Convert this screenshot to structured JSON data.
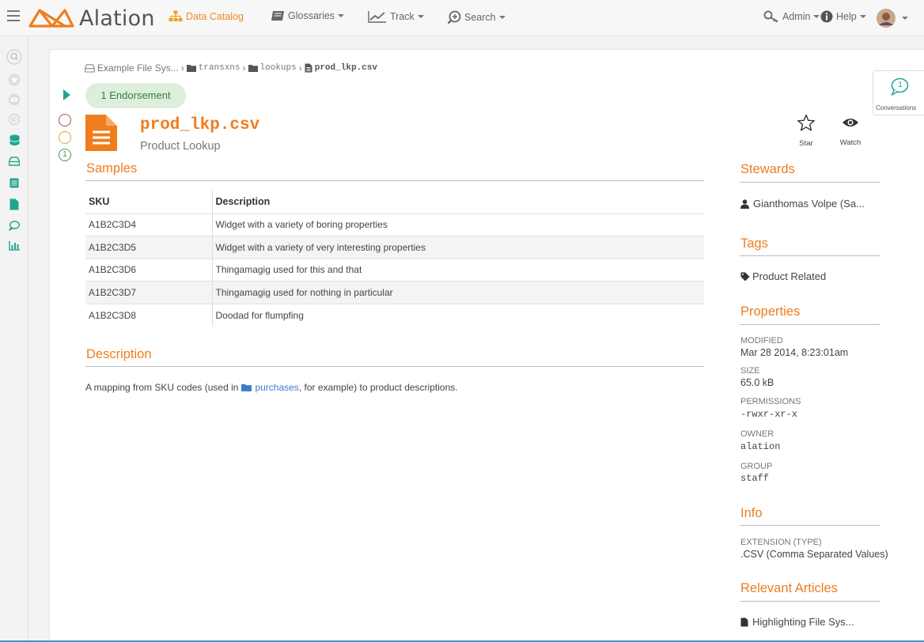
{
  "nav": {
    "brand": "Alation",
    "items": [
      {
        "label": "Data Catalog",
        "icon": "sitemap-icon"
      },
      {
        "label": "Glossaries",
        "icon": "book-icon"
      },
      {
        "label": "Track",
        "icon": "line-chart-icon"
      },
      {
        "label": "Search",
        "icon": "search-plus-icon"
      }
    ],
    "admin": "Admin",
    "help": "Help"
  },
  "breadcrumb": {
    "root": "Example File Sys...",
    "dir1": "transxns",
    "dir2": "lookups",
    "file": "prod_lkp.csv"
  },
  "endorsement": "1 Endorsement",
  "flags": {
    "endorse_count": "1"
  },
  "header": {
    "title": "prod_lkp.csv",
    "subtitle": "Product Lookup",
    "star": "Star",
    "watch": "Watch"
  },
  "conversations": {
    "count": "1",
    "label": "Conversations"
  },
  "samples": {
    "heading": "Samples",
    "columns": [
      "SKU",
      "Description"
    ],
    "rows": [
      [
        "A1B2C3D4",
        "Widget with a variety of boring properties"
      ],
      [
        "A1B2C3D5",
        "Widget with a variety of very interesting properties"
      ],
      [
        "A1B2C3D6",
        "Thingamagig used for this and that"
      ],
      [
        "A1B2C3D7",
        "Thingamagig used for nothing in particular"
      ],
      [
        "A1B2C3D8",
        "Doodad for flumpfing"
      ]
    ]
  },
  "description": {
    "heading": "Description",
    "before": "A mapping from SKU codes (used in",
    "link": "purchases",
    "after": ", for example) to product descriptions."
  },
  "stewards": {
    "heading": "Stewards",
    "name": "Gianthomas Volpe (Sa..."
  },
  "tags": {
    "heading": "Tags",
    "item": "Product Related"
  },
  "properties": {
    "heading": "Properties",
    "modified_k": "MODIFIED",
    "modified_v": "Mar 28 2014, 8:23:01am",
    "size_k": "SIZE",
    "size_v": "65.0 kB",
    "perm_k": "PERMISSIONS",
    "perm_v": "-rwxr-xr-x",
    "owner_k": "OWNER",
    "owner_v": "alation",
    "group_k": "GROUP",
    "group_v": "staff"
  },
  "info": {
    "heading": "Info",
    "ext_k": "EXTENSION (TYPE)",
    "ext_v": ".CSV (Comma Separated Values)"
  },
  "articles": {
    "heading": "Relevant Articles",
    "item": "Highlighting File Sys..."
  },
  "colors": {
    "accent": "#f07d1e",
    "teal": "#1fa58f",
    "link": "#3d7cc9"
  }
}
